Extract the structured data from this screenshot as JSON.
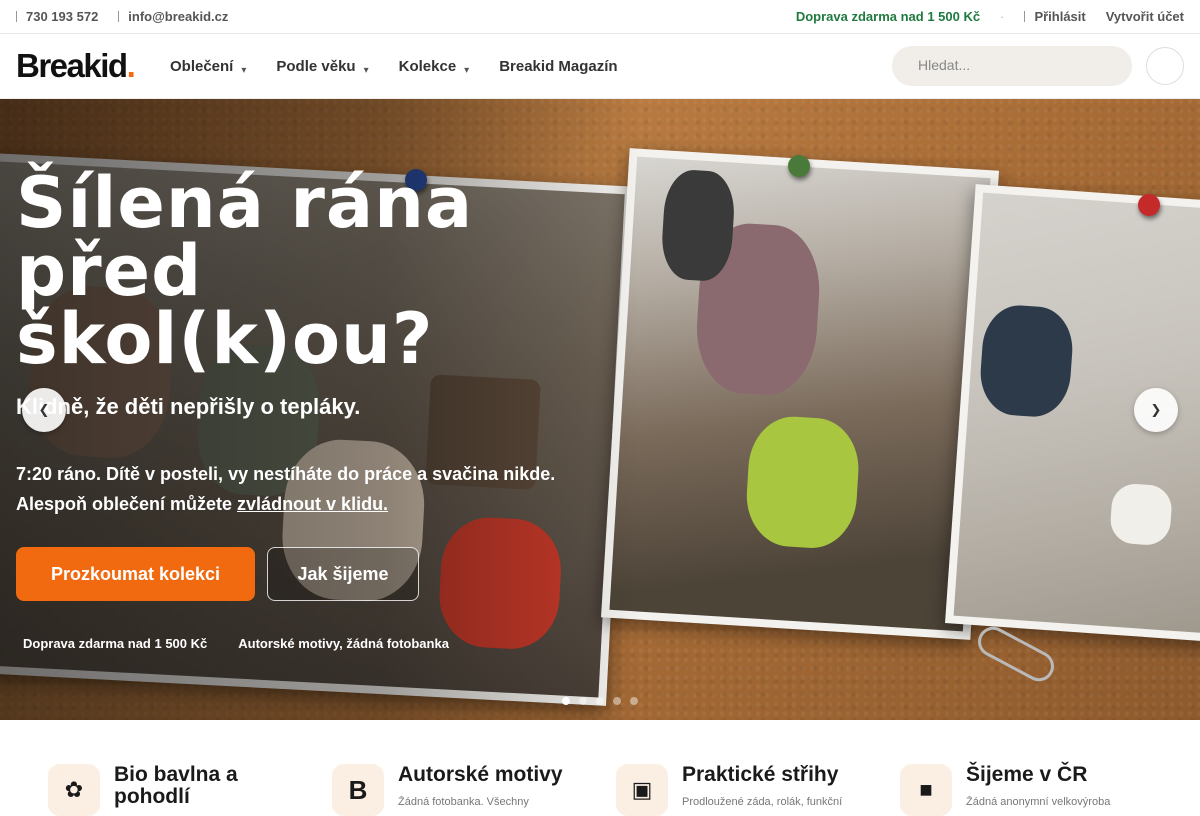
{
  "topbar": {
    "phone": "730 193 572",
    "email": "info@breakid.cz",
    "shipping": "Doprava zdarma nad 1 500 Kč",
    "separator": "·",
    "login": "Přihlásit",
    "register": "Vytvořit účet"
  },
  "header": {
    "logo_text": "Breakid",
    "logo_dot": ".",
    "nav": [
      {
        "label": "Oblečení",
        "has_dropdown": true
      },
      {
        "label": "Podle věku",
        "has_dropdown": true
      },
      {
        "label": "Kolekce",
        "has_dropdown": true
      },
      {
        "label": "Breakid Magazín",
        "has_dropdown": false
      }
    ],
    "search_placeholder": "Hledat..."
  },
  "hero": {
    "title": "Šílená rána před škol(k)ou?",
    "subtitle": "Klidně, že děti nepřišly o tepláky.",
    "text_before_link": "7:20 ráno. Dítě v posteli, vy nestíháte do práce a svačina nikde. Alespoň oblečení můžete ",
    "text_link": "zvládnout v klidu.",
    "primary_button": "Prozkoumat kolekci",
    "secondary_button": "Jak šijeme",
    "perks": [
      "Doprava zdarma nad 1 500 Kč",
      "Autorské motivy, žádná fotobanka"
    ],
    "slides_total": 5,
    "active_slide": 1
  },
  "features": [
    {
      "icon": "cotton-icon",
      "title": "Bio bavlna a pohodlí",
      "desc": ""
    },
    {
      "icon": "brand-b-icon",
      "title": "Autorské motivy",
      "desc": "Žádná fotobanka. Všechny"
    },
    {
      "icon": "tshirt-icon",
      "title": "Praktické střihy",
      "desc": "Prodloužené záda, rolák, funkční"
    },
    {
      "icon": "czech-map-icon",
      "title": "Šijeme v ČR",
      "desc": "Žádná anonymní velkovýroba"
    }
  ],
  "colors": {
    "accent": "#f26a10",
    "shipping_green": "#1f7a3f",
    "search_bg": "#f1ede8",
    "cork": "#a86c36"
  }
}
